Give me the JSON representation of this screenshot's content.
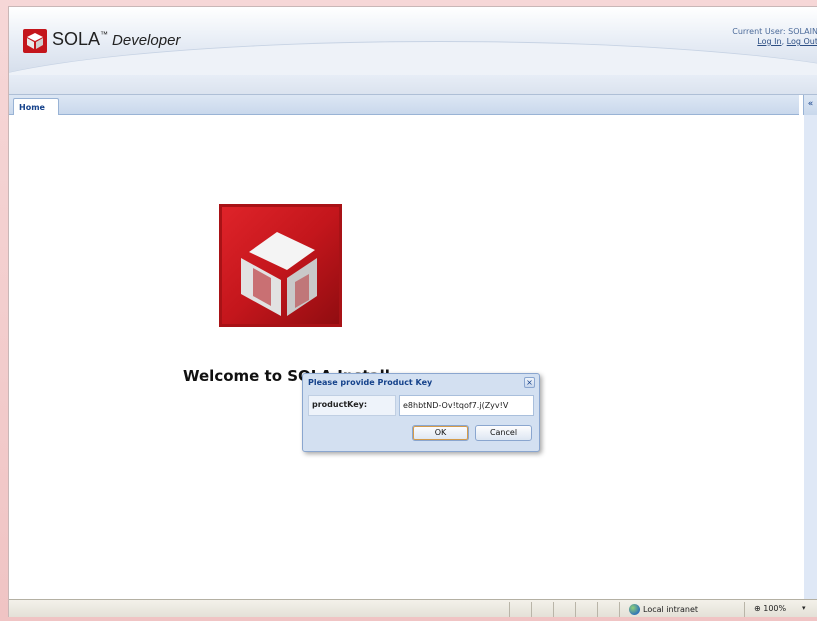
{
  "header": {
    "brand_name": "SOLA",
    "brand_tm": "™",
    "brand_edition": "Developer",
    "current_user_label": "Current User: SOLAIN",
    "login_link": "Log In",
    "link_separator": ",",
    "logout_link": "Log Out"
  },
  "tabs": [
    {
      "label": "Home",
      "active": true
    }
  ],
  "collapse_button": "«",
  "content": {
    "welcome_text": "Welcome to SOLA Install"
  },
  "dialog": {
    "title": "Please provide Product Key",
    "close_glyph": "×",
    "field_label": "productKey:",
    "field_value": "e8hbtND-Ov!tqof7.j(Zyv!V",
    "ok_label": "OK",
    "cancel_label": "Cancel"
  },
  "statusbar": {
    "zone": "Local intranet",
    "zoom": "100%",
    "zoom_icon": "magnifier-icon",
    "zoom_dropdown": "▾"
  },
  "colors": {
    "brand_red": "#c4161c",
    "ext_blue": "#15428b",
    "frame_pink": "#f3cfcf"
  }
}
